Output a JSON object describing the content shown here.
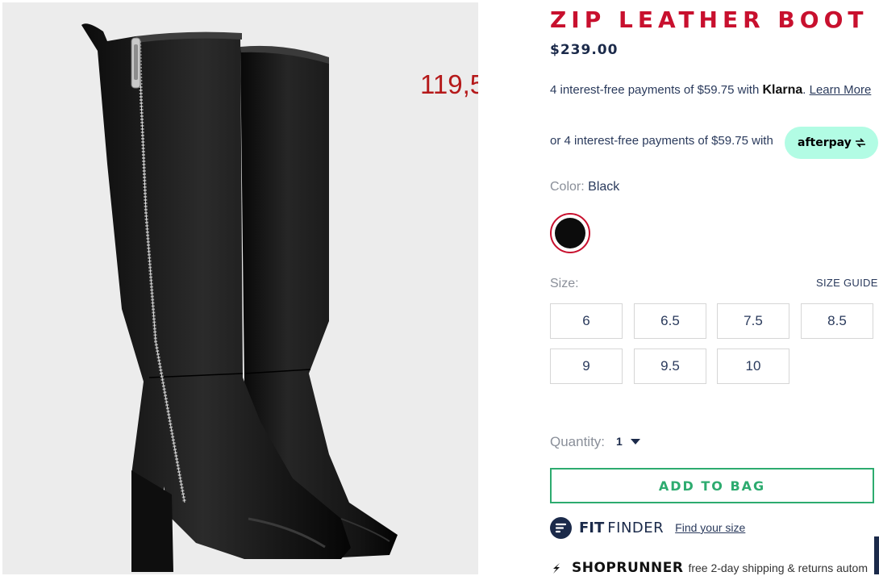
{
  "product": {
    "title": "ZIP LEATHER BOOT",
    "price": "$239.00",
    "overlay_price": "119,5"
  },
  "klarna": {
    "prefix": "4 interest-free payments of $59.75 with ",
    "brand": "Klarna",
    "separator": ". ",
    "link": "Learn More"
  },
  "afterpay": {
    "text": "or 4 interest-free payments of $59.75 with",
    "badge": "afterpay"
  },
  "color": {
    "label": "Color:",
    "value": "Black",
    "swatch_hex": "#0c0c0c"
  },
  "size": {
    "label": "Size:",
    "guide": "SIZE GUIDE",
    "options": [
      "6",
      "6.5",
      "7.5",
      "8.5",
      "9",
      "9.5",
      "10"
    ]
  },
  "quantity": {
    "label": "Quantity:",
    "value": "1"
  },
  "add_to_bag": "ADD TO BAG",
  "fit_finder": {
    "bold": "FIT",
    "light": "FINDER",
    "link": "Find your size"
  },
  "shoprunner": {
    "brand": "SHOPRUNNER",
    "text": "free 2-day shipping & returns autom"
  },
  "colors": {
    "title_red": "#c8102e",
    "navy": "#1b2a4a",
    "green": "#2dab6f",
    "afterpay_mint": "#b2fce4"
  }
}
